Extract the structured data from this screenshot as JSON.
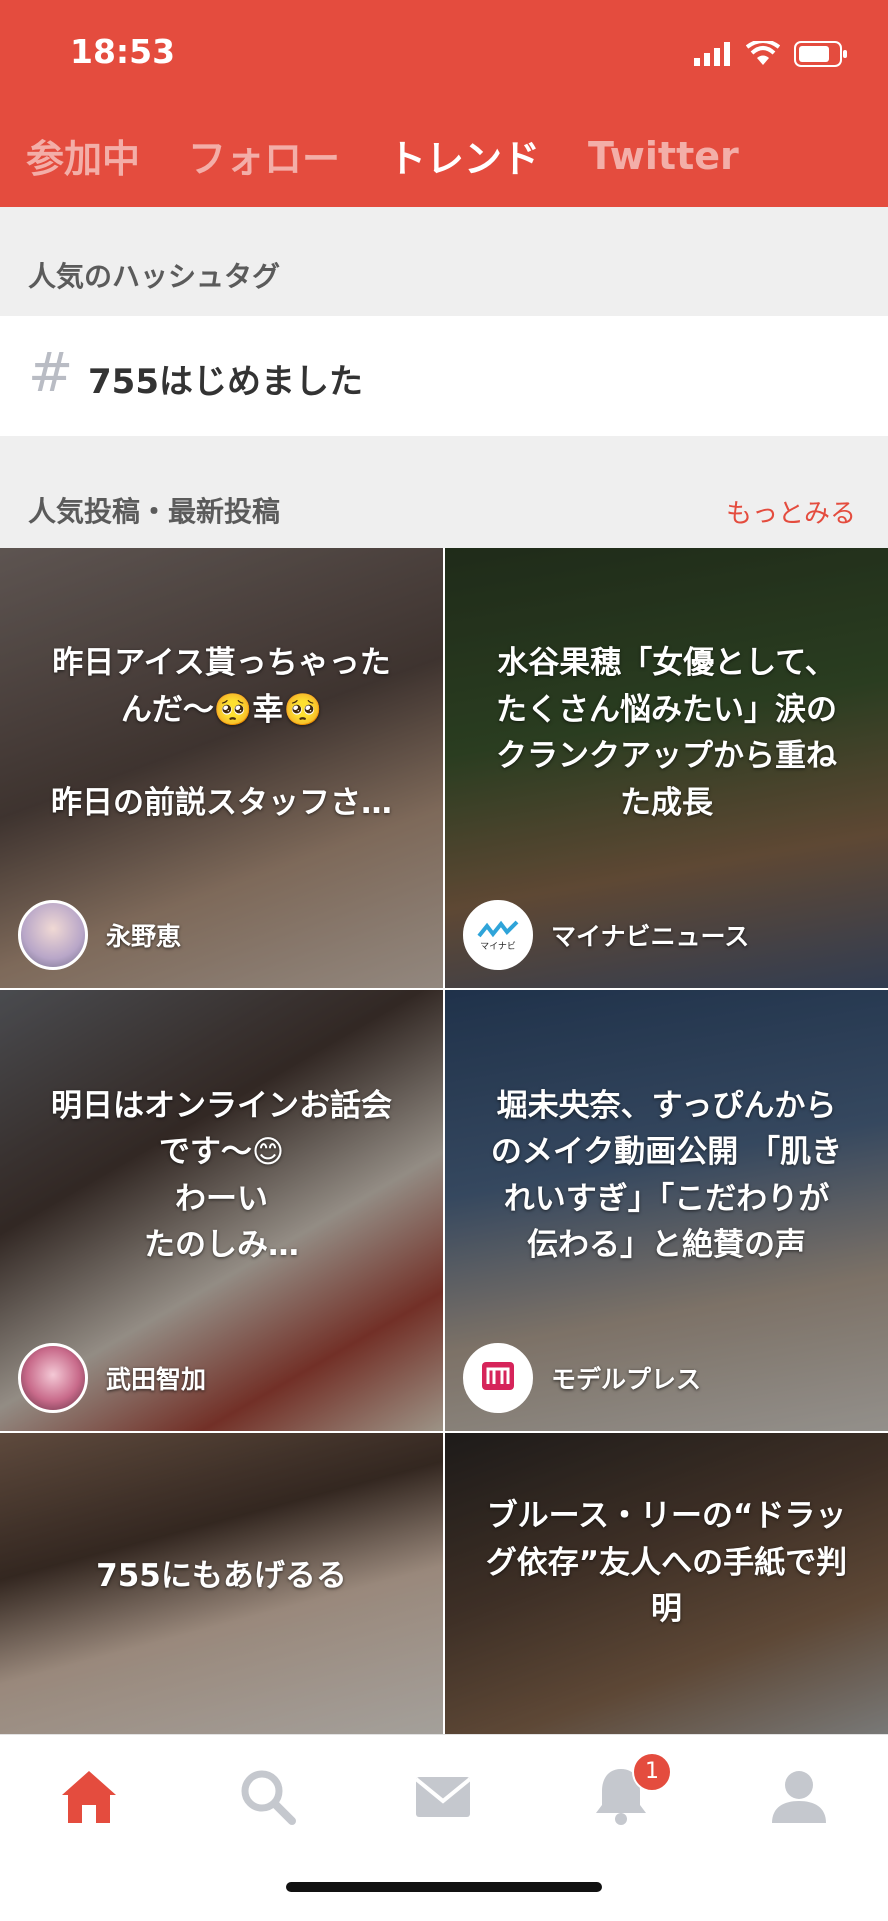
{
  "status_bar": {
    "time": "18:53"
  },
  "tabs": [
    {
      "label": "参加中",
      "active": false
    },
    {
      "label": "フォロー",
      "active": false
    },
    {
      "label": "トレンド",
      "active": true
    },
    {
      "label": "Twitter",
      "active": false
    }
  ],
  "hashtags": {
    "title": "人気のハッシュタグ",
    "items": [
      {
        "icon": "hash-icon",
        "label": "755はじめました"
      }
    ]
  },
  "posts": {
    "title": "人気投稿・最新投稿",
    "more_label": "もっとみる",
    "cards": [
      {
        "title": "昨日アイス貰っちゃった\nんだ〜🥺幸🥺\n\n昨日の前説スタッフさ…",
        "author": "永野恵",
        "avatar": "avatar-photo"
      },
      {
        "title": "水谷果穂「女優として、\nたくさん悩みたい」涙の\nクランクアップから重ね\nた成長",
        "author": "マイナビニュース",
        "avatar": "mynavi-logo"
      },
      {
        "title": "明日はオンラインお話会\nです〜😊\nわーい\nたのしみ…",
        "author": "武田智加",
        "avatar": "avatar-photo"
      },
      {
        "title": "堀未央奈、すっぴんから\nのメイク動画公開 「肌き\nれいすぎ」「こだわりが\n伝わる」と絶賛の声",
        "author": "モデルプレス",
        "avatar": "modelpress-logo"
      },
      {
        "title": "755にもあげるる",
        "author": "",
        "avatar": ""
      },
      {
        "title": "ブルース・リーの“ドラッ\nグ依存”友人への手紙で判\n明",
        "author": "",
        "avatar": ""
      }
    ]
  },
  "nav": {
    "items": [
      "home-icon",
      "search-icon",
      "mail-icon",
      "bell-icon",
      "profile-icon"
    ],
    "notification_count": "1"
  },
  "colors": {
    "accent": "#e44c3e",
    "section_bg": "#efefef",
    "inactive_icon": "#c5c8ce"
  }
}
